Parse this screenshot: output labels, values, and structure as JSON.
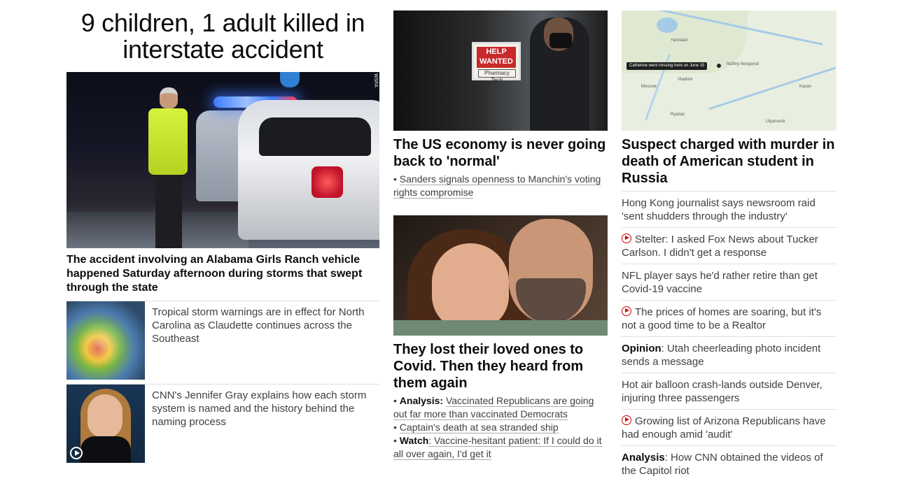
{
  "left": {
    "headline": "9 children, 1 adult killed in interstate accident",
    "hero_image_credit": "WSFA",
    "hero_caption": "The accident involving an Alabama Girls Ranch vehicle happened Saturday afternoon during storms that swept through the state",
    "stories": [
      {
        "text": "Tropical storm warnings are in effect for North Carolina as Claudette continues across the Southeast",
        "thumb_icon": "weather-radar-image"
      },
      {
        "text": "CNN's Jennifer Gray explains how each storm system is named and the history behind the naming process",
        "thumb_icon": "play-icon"
      }
    ]
  },
  "middle": {
    "story1": {
      "sign_text": "HELP WANTED",
      "sign_tag": "Pharmacy Tech",
      "headline": "The US economy is never going back to 'normal'",
      "bullets": [
        {
          "prefix": "",
          "text": "Sanders signals openness to Manchin's voting rights compromise"
        }
      ]
    },
    "story2": {
      "headline": "They lost their loved ones to Covid. Then they heard from them again",
      "bullets": [
        {
          "prefix": "Analysis:",
          "text": "Vaccinated Republicans are going out far more than vaccinated Democrats"
        },
        {
          "prefix": "",
          "text": "Captain's death at sea stranded ship"
        },
        {
          "prefix": "Watch",
          "text": ": Vaccine-hesitant patient: If I could do it all over again, I'd get it"
        }
      ]
    }
  },
  "right": {
    "map_callout": "Catherine went missing here on June 15",
    "map_labels": [
      "Yaroslavl",
      "Moscow",
      "Nizhny Novgorod",
      "Kazan",
      "Vladimir",
      "Ryazan",
      "Ulyanovsk"
    ],
    "headline": "Suspect charged with murder in death of American student in Russia",
    "items": [
      {
        "video": false,
        "prefix": "",
        "text": "Hong Kong journalist says newsroom raid 'sent shudders through the industry'"
      },
      {
        "video": true,
        "prefix": "",
        "text": "Stelter: I asked Fox News about Tucker Carlson. I didn't get a response"
      },
      {
        "video": false,
        "prefix": "",
        "text": "NFL player says he'd rather retire than get Covid-19 vaccine"
      },
      {
        "video": true,
        "prefix": "",
        "text": "The prices of homes are soaring, but it's not a good time to be a Realtor"
      },
      {
        "video": false,
        "prefix": "Opinion",
        "text": ": Utah cheerleading photo incident sends a message"
      },
      {
        "video": false,
        "prefix": "",
        "text": "Hot air balloon crash-lands outside Denver, injuring three passengers"
      },
      {
        "video": true,
        "prefix": "",
        "text": "Growing list of Arizona Republicans have had enough amid 'audit'"
      },
      {
        "video": false,
        "prefix": "Analysis",
        "text": ": How CNN obtained the videos of the Capitol riot"
      }
    ]
  }
}
